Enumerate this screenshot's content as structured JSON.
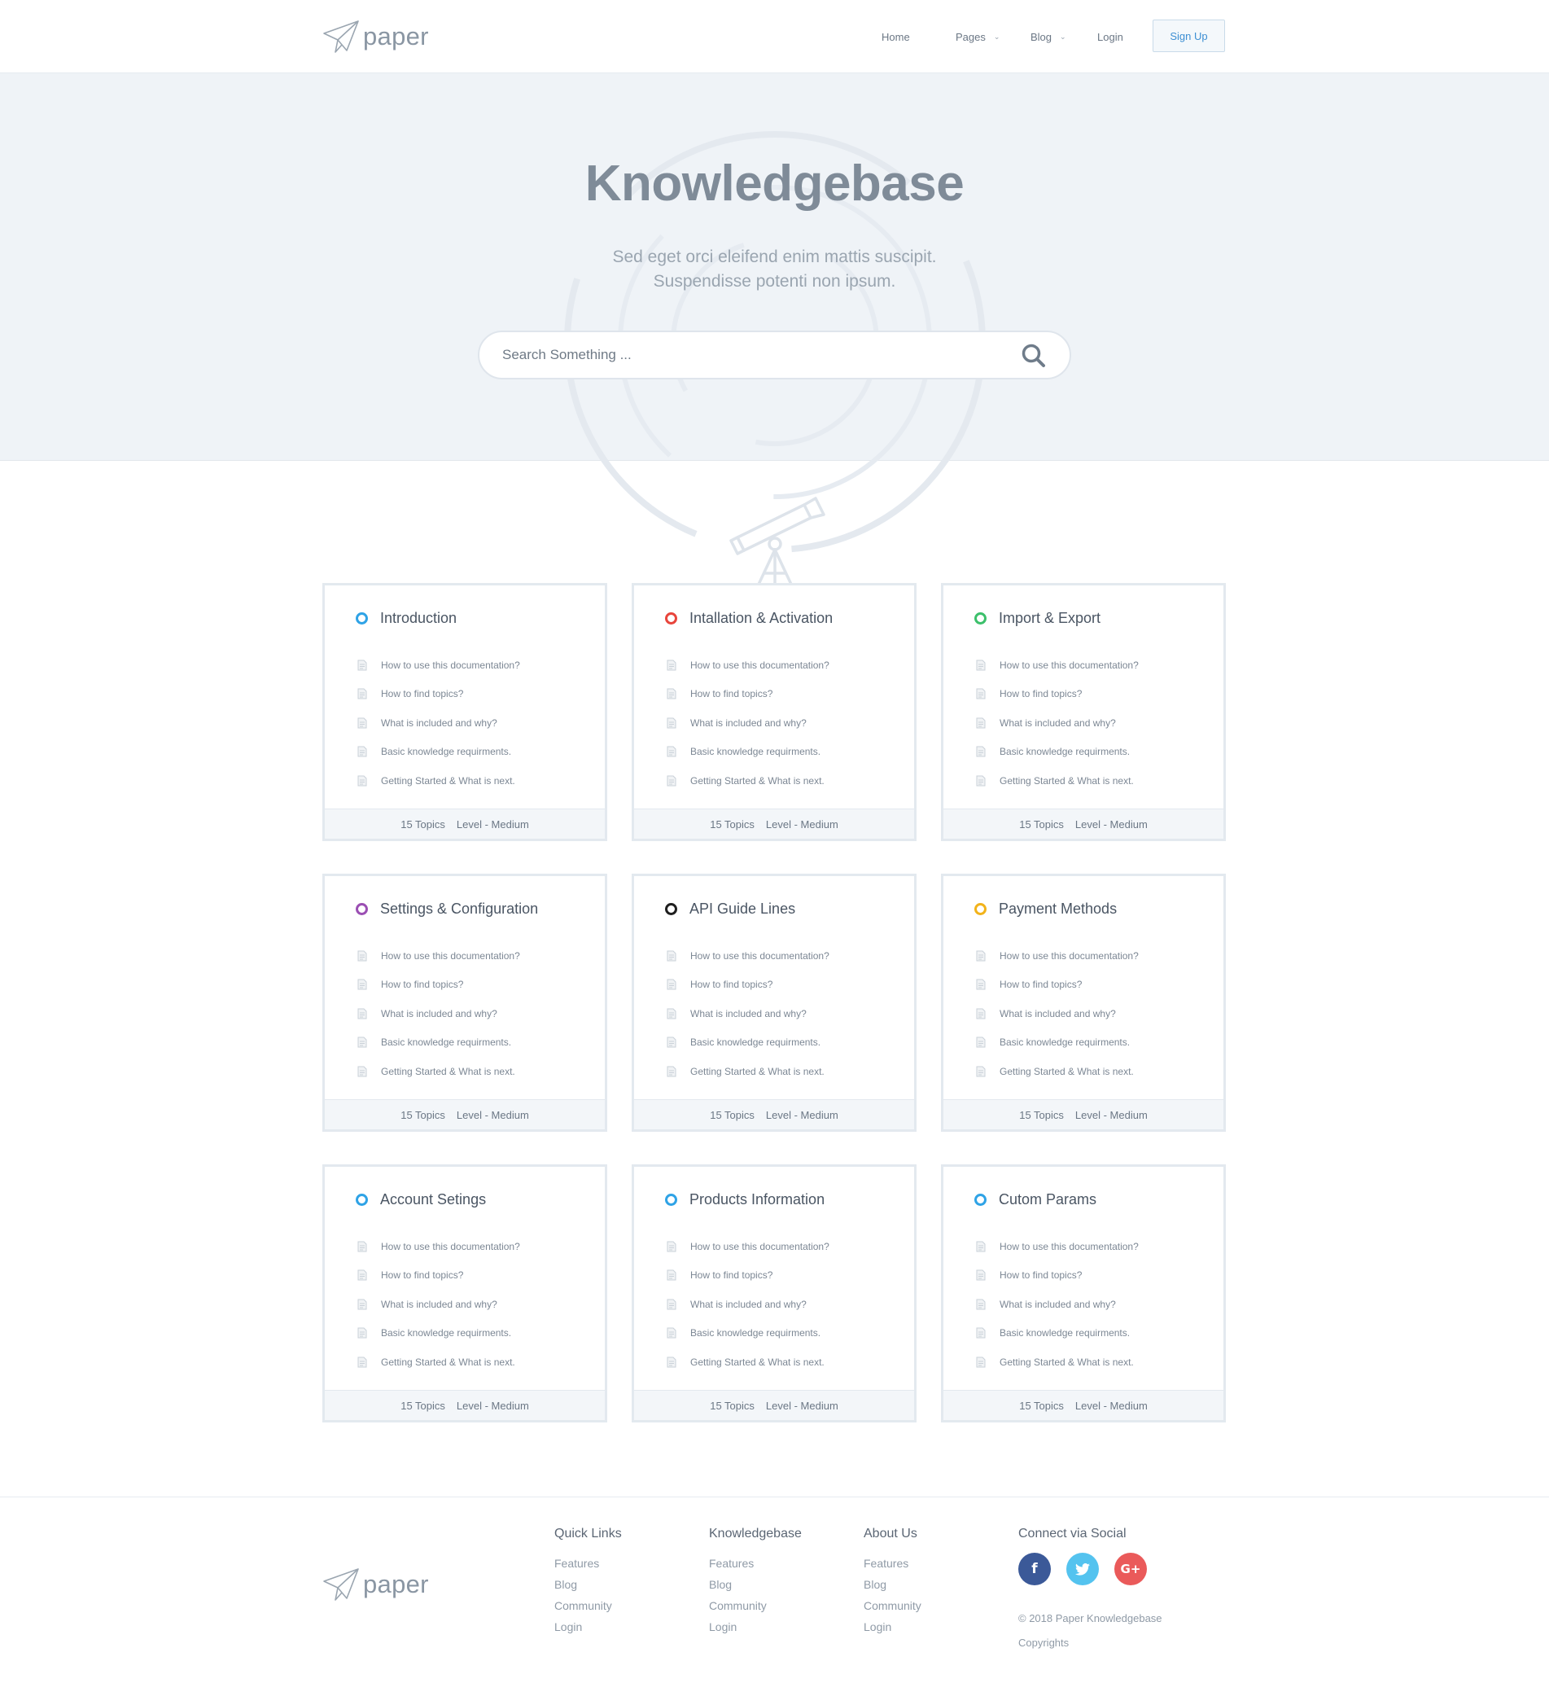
{
  "brand": {
    "name": "paper"
  },
  "nav": {
    "items": [
      {
        "label": "Home",
        "has_dropdown": false
      },
      {
        "label": "Pages",
        "has_dropdown": true
      },
      {
        "label": "Blog",
        "has_dropdown": true
      },
      {
        "label": "Login",
        "has_dropdown": false
      }
    ],
    "signup_label": "Sign Up"
  },
  "hero": {
    "title": "Knowledgebase",
    "subtitle_line1": "Sed eget orci eleifend enim mattis suscipit.",
    "subtitle_line2": "Suspendisse potenti non ipsum.",
    "search_placeholder": "Search Something ..."
  },
  "colors": {
    "accent": "#3d8fd3",
    "ring_blue": "#2fa3e6",
    "ring_red": "#e8453c",
    "ring_green": "#3cc06b",
    "ring_purple": "#9b4fb3",
    "ring_black": "#1f1f1f",
    "ring_yellow": "#f2b31b",
    "facebook": "#3b5998",
    "twitter": "#54c3ef",
    "google": "#ea5a5a"
  },
  "cards": [
    {
      "title": "Introduction",
      "ring": "#2fa3e6",
      "items": [
        "How to use this documentation?",
        "How to find topics?",
        "What is included and why?",
        "Basic knowledge requirments.",
        "Getting Started & What is next."
      ],
      "topics": "15 Topics",
      "level": "Level - Medium"
    },
    {
      "title": "Intallation & Activation",
      "ring": "#e8453c",
      "items": [
        "How to use this documentation?",
        "How to find topics?",
        "What is included and why?",
        "Basic knowledge requirments.",
        "Getting Started & What is next."
      ],
      "topics": "15 Topics",
      "level": "Level - Medium"
    },
    {
      "title": "Import & Export",
      "ring": "#3cc06b",
      "items": [
        "How to use this documentation?",
        "How to find topics?",
        "What is included and why?",
        "Basic knowledge requirments.",
        "Getting Started & What is next."
      ],
      "topics": "15 Topics",
      "level": "Level - Medium"
    },
    {
      "title": "Settings & Configuration",
      "ring": "#9b4fb3",
      "items": [
        "How to use this documentation?",
        "How to find topics?",
        "What is included and why?",
        "Basic knowledge requirments.",
        "Getting Started & What is next."
      ],
      "topics": "15 Topics",
      "level": "Level - Medium"
    },
    {
      "title": "API Guide Lines",
      "ring": "#1f1f1f",
      "items": [
        "How to use this documentation?",
        "How to find topics?",
        "What is included and why?",
        "Basic knowledge requirments.",
        "Getting Started & What is next."
      ],
      "topics": "15 Topics",
      "level": "Level - Medium"
    },
    {
      "title": "Payment Methods",
      "ring": "#f2b31b",
      "items": [
        "How to use this documentation?",
        "How to find topics?",
        "What is included and why?",
        "Basic knowledge requirments.",
        "Getting Started & What is next."
      ],
      "topics": "15 Topics",
      "level": "Level - Medium"
    },
    {
      "title": "Account Setings",
      "ring": "#2fa3e6",
      "items": [
        "How to use this documentation?",
        "How to find topics?",
        "What is included and why?",
        "Basic knowledge requirments.",
        "Getting Started & What is next."
      ],
      "topics": "15 Topics",
      "level": "Level - Medium"
    },
    {
      "title": "Products Information",
      "ring": "#2fa3e6",
      "items": [
        "How to use this documentation?",
        "How to find topics?",
        "What is included and why?",
        "Basic knowledge requirments.",
        "Getting Started & What is next."
      ],
      "topics": "15 Topics",
      "level": "Level - Medium"
    },
    {
      "title": "Cutom Params",
      "ring": "#2fa3e6",
      "items": [
        "How to use this documentation?",
        "How to find topics?",
        "What is included and why?",
        "Basic knowledge requirments.",
        "Getting Started & What is next."
      ],
      "topics": "15 Topics",
      "level": "Level - Medium"
    }
  ],
  "footer": {
    "columns": [
      {
        "heading": "Quick Links",
        "links": [
          "Features",
          "Blog",
          "Community",
          "Login"
        ]
      },
      {
        "heading": "Knowledgebase",
        "links": [
          "Features",
          "Blog",
          "Community",
          "Login"
        ]
      },
      {
        "heading": "About Us",
        "links": [
          "Features",
          "Blog",
          "Community",
          "Login"
        ]
      }
    ],
    "social": {
      "heading": "Connect via Social",
      "items": [
        {
          "name": "facebook",
          "glyph": "f",
          "color": "#3b5998"
        },
        {
          "name": "twitter",
          "glyph": "t",
          "color": "#54c3ef"
        },
        {
          "name": "google-plus",
          "glyph": "G+",
          "color": "#ea5a5a"
        }
      ]
    },
    "copyright_line1": "© 2018 Paper Knowledgebase",
    "copyright_line2": "Copyrights"
  }
}
